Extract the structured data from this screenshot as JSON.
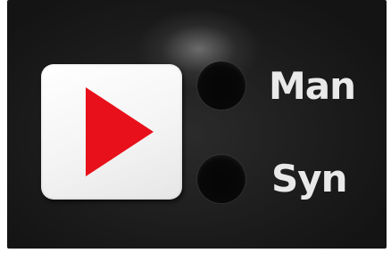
{
  "labels": {
    "man": "Man",
    "syn": "Syn"
  },
  "icons": {
    "play": "play-icon"
  },
  "colors": {
    "panel": "#1f1f1f",
    "button": "#f4f4f4",
    "play_arrow": "#e8101a",
    "label_text": "#e9e9e9",
    "led_off": "#080808"
  }
}
